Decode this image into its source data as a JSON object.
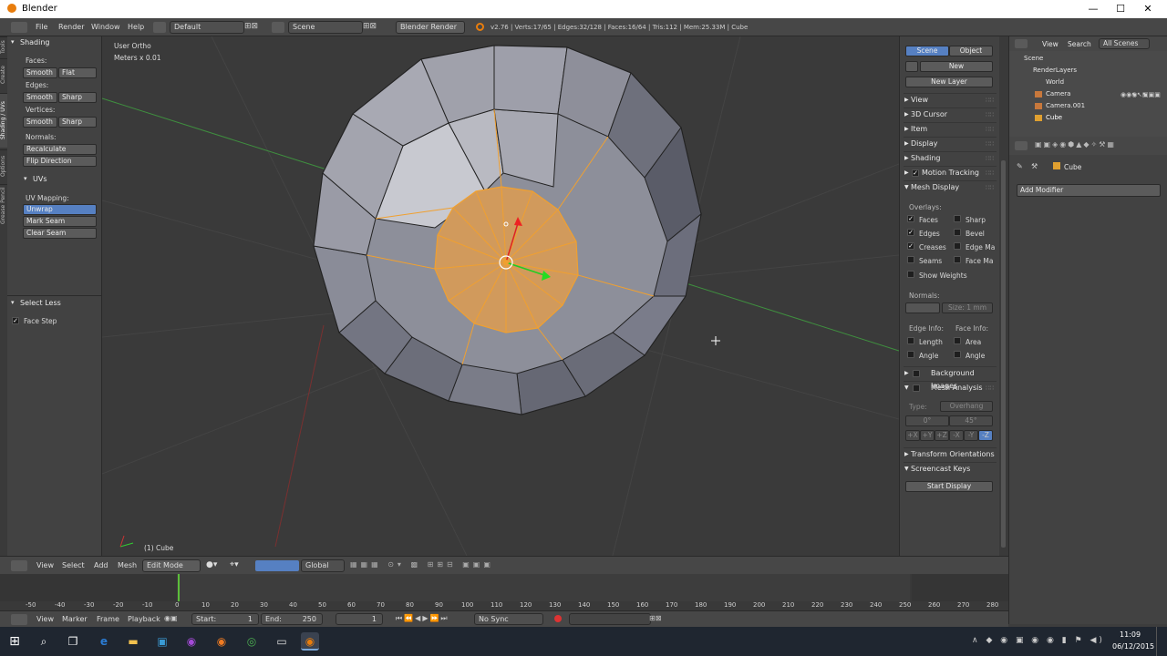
{
  "app": {
    "title": "Blender"
  },
  "window_controls": {
    "minimize": "—",
    "maximize": "☐",
    "close": "✕"
  },
  "topbar": {
    "menus": [
      "File",
      "Render",
      "Window",
      "Help"
    ],
    "layout": "Default",
    "scene": "Scene",
    "engine": "Blender Render",
    "stats": "v2.76 | Verts:17/65 | Edges:32/128 | Faces:16/64 | Tris:112 | Mem:25.33M | Cube"
  },
  "toolshelf": {
    "tabs": [
      "Tools",
      "Create",
      "Shading / UVs",
      "Options",
      "Grease Pencil"
    ],
    "shading": {
      "header": "Shading",
      "faces_label": "Faces:",
      "faces_smooth": "Smooth",
      "faces_flat": "Flat",
      "edges_label": "Edges:",
      "edges_smooth": "Smooth",
      "edges_sharp": "Sharp",
      "vertices_label": "Vertices:",
      "vertices_smooth": "Smooth",
      "vertices_sharp": "Sharp",
      "normals_label": "Normals:",
      "recalculate": "Recalculate",
      "flip_direction": "Flip Direction"
    },
    "uvs": {
      "header": "UVs",
      "mapping_label": "UV Mapping:",
      "unwrap": "Unwrap",
      "mark_seam": "Mark Seam",
      "clear_seam": "Clear Seam"
    },
    "operator": {
      "header": "Select Less",
      "face_step": "Face Step",
      "face_step_checked": true
    }
  },
  "viewport": {
    "view_label": "User Ortho",
    "scale_label": "Meters x 0.01",
    "object_label": "(1) Cube"
  },
  "npanel": {
    "scene_tab": "Scene",
    "object_tab": "Object",
    "new": "New",
    "new_layer": "New Layer",
    "sections": [
      "View",
      "3D Cursor",
      "Item",
      "Display",
      "Shading"
    ],
    "motion_tracking": "Motion Tracking",
    "mesh_display": "Mesh Display",
    "overlays_label": "Overlays:",
    "overlays": [
      {
        "label": "Faces",
        "checked": true
      },
      {
        "label": "Sharp",
        "checked": false
      },
      {
        "label": "Edges",
        "checked": true
      },
      {
        "label": "Bevel",
        "checked": false
      },
      {
        "label": "Creases",
        "checked": true
      },
      {
        "label": "Edge Ma",
        "checked": false
      },
      {
        "label": "Seams",
        "checked": false
      },
      {
        "label": "Face Ma",
        "checked": false
      }
    ],
    "show_weights": "Show Weights",
    "normals_label": "Normals:",
    "normals_size": "Size: 1 mm",
    "edge_info": "Edge Info:",
    "face_info": "Face Info:",
    "length": "Length",
    "area": "Area",
    "angle1": "Angle",
    "angle2": "Angle",
    "background_images": "Background Images",
    "mesh_analysis": "Mesh Analysis",
    "type_label": "Type:",
    "type_value": "Overhang",
    "range_min": "0°",
    "range_max": "45°",
    "axis_buttons": [
      "+X",
      "+Y",
      "+Z",
      "-X",
      "-Y",
      "-Z"
    ],
    "transform_orientations": "Transform Orientations",
    "screencast_keys": "Screencast Keys",
    "start_display": "Start Display"
  },
  "outliner": {
    "view": "View",
    "search": "Search",
    "filter": "All Scenes",
    "items": [
      "Scene",
      "RenderLayers",
      "World",
      "Camera",
      "Camera.001",
      "Cube"
    ]
  },
  "properties": {
    "object_name": "Cube",
    "add_modifier": "Add Modifier"
  },
  "vphead": {
    "view": "View",
    "select": "Select",
    "add": "Add",
    "mesh": "Mesh",
    "mode": "Edit Mode",
    "orientation": "Global"
  },
  "timeline": {
    "ticks": [
      "-50",
      "-40",
      "-30",
      "-20",
      "-10",
      "0",
      "10",
      "20",
      "30",
      "40",
      "50",
      "60",
      "70",
      "80",
      "90",
      "100",
      "110",
      "120",
      "130",
      "140",
      "150",
      "160",
      "170",
      "180",
      "190",
      "200",
      "210",
      "220",
      "230",
      "240",
      "250",
      "260",
      "270",
      "280"
    ],
    "view": "View",
    "marker": "Marker",
    "frame": "Frame",
    "playback": "Playback",
    "start_label": "Start:",
    "start_value": "1",
    "end_label": "End:",
    "end_value": "250",
    "current": "1",
    "sync": "No Sync"
  },
  "taskbar": {
    "time": "11:09",
    "date": "06/12/2015"
  }
}
